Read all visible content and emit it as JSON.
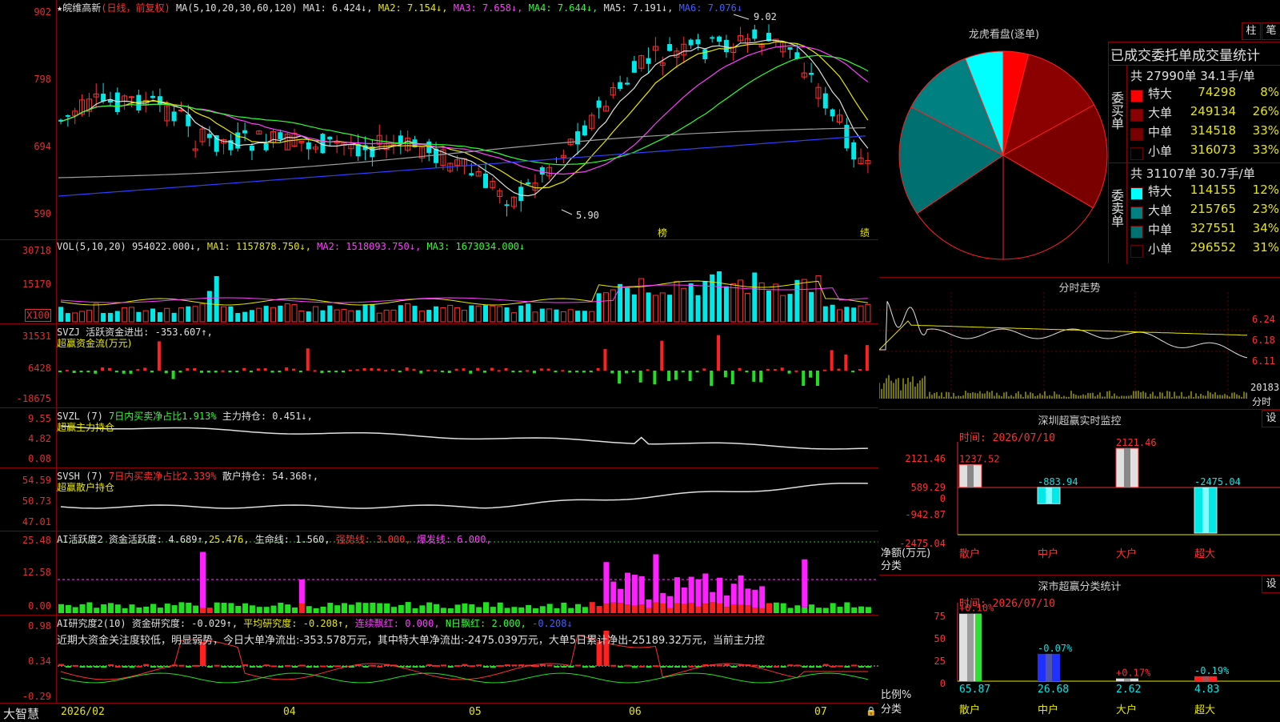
{
  "stock": {
    "title": "皖维高新",
    "mode": "(日线，前复权)"
  },
  "ma": {
    "label": "MA(5,10,20,30,60,120)",
    "ma1": "MA1: 6.424↓,",
    "ma2": "MA2: 7.154↓,",
    "ma3": "MA3: 7.658↓,",
    "ma4": "MA4: 7.644↓,",
    "ma5": "MA5: 7.191↓,",
    "ma6": "MA6: 7.076↓"
  },
  "price_axis": [
    "902",
    "798",
    "694",
    "590"
  ],
  "price_marks": {
    "high": "9.02",
    "low": "5.90",
    "tag1": "榜",
    "tag2": "绩"
  },
  "vol": {
    "label": "VOL(5,10,20)",
    "val": "954022.000↓,",
    "ma1": "MA1: 1157878.750↓,",
    "ma2": "MA2: 1518093.750↓,",
    "ma3": "MA3: 1673034.000↓",
    "axis": [
      "30718",
      "15170",
      "X100"
    ]
  },
  "svzj": {
    "label": "SVZJ",
    "text": "活跃资金进出: -353.607↑,",
    "sub": "超赢资金流(万元)",
    "axis": [
      "31531",
      "6428",
      "-18675"
    ]
  },
  "svzl": {
    "label": "SVZL (7)",
    "text": "7日内买卖净占比1.913%",
    "hold": "主力持仓: 0.451↓,",
    "sub": "超赢主力持仓",
    "axis": [
      "9.55",
      "4.82",
      "0.08"
    ]
  },
  "svsh": {
    "label": "SVSH (7)",
    "text": "7日内买卖净占比2.339%",
    "hold": "散户持仓: 54.368↑,",
    "sub": "超赢散户持仓",
    "axis": [
      "54.59",
      "50.73",
      "47.01"
    ]
  },
  "ai1": {
    "label": "AI活跃度2",
    "a": "资金活跃度: 4.689↑,",
    "b": "25.476,",
    "c": "生命线: 1.560,",
    "d": "强势线: 3.000,",
    "e": "爆发线: 6.000,",
    "axis": [
      "25.48",
      "12.58",
      "0.00"
    ]
  },
  "ai2": {
    "label": "AI研究度2(10)",
    "a": "资金研究度: -0.029↑,",
    "b": "平均研究度: -0.208↑,",
    "c": "连续飘红: 0.000,",
    "d": "N日飘红: 2.000,",
    "e": "-0.208↓",
    "commentary": "近期大资金关注度较低，明显弱势，今日大单净流出:-353.578万元，其中特大单净流出:-2475.039万元，大单5日累计净出-25189.32万元，当前主力控",
    "axis": [
      "0.98",
      "0.34",
      "-0.29"
    ]
  },
  "dates": [
    "2026/02",
    "04",
    "05",
    "06",
    "07"
  ],
  "brand": "大智慧",
  "lhb": {
    "title": "龙虎看盘(逐单)",
    "btn1": "柱",
    "btn2": "笔",
    "stats_title": "已成交委托单成交量统计",
    "buy_header": "共 27990单 34.1手/单",
    "buy_label": "委买单",
    "sell_header": "共 31107单 30.7手/单",
    "sell_label": "委卖单",
    "buy": [
      {
        "label": "特大",
        "value": "74298",
        "pct": "8%",
        "color": "#ff0000"
      },
      {
        "label": "大单",
        "value": "249134",
        "pct": "26%",
        "color": "#8b0000"
      },
      {
        "label": "中单",
        "value": "314518",
        "pct": "33%",
        "color": "#7a0000"
      },
      {
        "label": "小单",
        "value": "316073",
        "pct": "33%",
        "color": "#000000"
      }
    ],
    "sell": [
      {
        "label": "特大",
        "value": "114155",
        "pct": "12%",
        "color": "#00ffff"
      },
      {
        "label": "大单",
        "value": "215765",
        "pct": "23%",
        "color": "#008080"
      },
      {
        "label": "中单",
        "value": "327551",
        "pct": "34%",
        "color": "#007070"
      },
      {
        "label": "小单",
        "value": "296552",
        "pct": "31%",
        "color": "#000000"
      }
    ]
  },
  "intraday": {
    "title": "分时走势",
    "axis": [
      "6.24",
      "6.18",
      "6.11"
    ],
    "vol": "20183",
    "vol_label": "分时"
  },
  "szmon": {
    "title": "深圳超赢实时监控",
    "btn": "设",
    "time": "时间: 2026/07/10",
    "axis": [
      "2121.46",
      "589.29",
      "0",
      "-942.87",
      "-2475.04"
    ],
    "ylabel": "净额(万元)",
    "xlabel": "分类",
    "bars": [
      {
        "cat": "散户",
        "value": 1237.52,
        "label": "1237.52"
      },
      {
        "cat": "中户",
        "value": -883.94,
        "label": "-883.94"
      },
      {
        "cat": "大户",
        "value": 2121.46,
        "label": "2121.46"
      },
      {
        "cat": "超大",
        "value": -2475.04,
        "label": "-2475.04"
      }
    ]
  },
  "szcls": {
    "title": "深市超赢分类统计",
    "btn": "设",
    "time": "时间: 2026/07/10",
    "axis": [
      "75",
      "50",
      "25",
      "0"
    ],
    "ylabel": "比例%",
    "xlabel": "分类",
    "bars": [
      {
        "cat": "散户",
        "value": 65.87,
        "label": "65.87",
        "chg": "+0.10%",
        "color": "#e0e0e0"
      },
      {
        "cat": "中户",
        "value": 26.68,
        "label": "26.68",
        "chg": "-0.07%",
        "color": "#2030ff"
      },
      {
        "cat": "大户",
        "value": 2.62,
        "label": "2.62",
        "chg": "+0.17%",
        "color": "#e0e0e0"
      },
      {
        "cat": "超大",
        "value": 4.83,
        "label": "4.83",
        "chg": "-0.19%",
        "color": "#ff2020"
      }
    ]
  }
}
